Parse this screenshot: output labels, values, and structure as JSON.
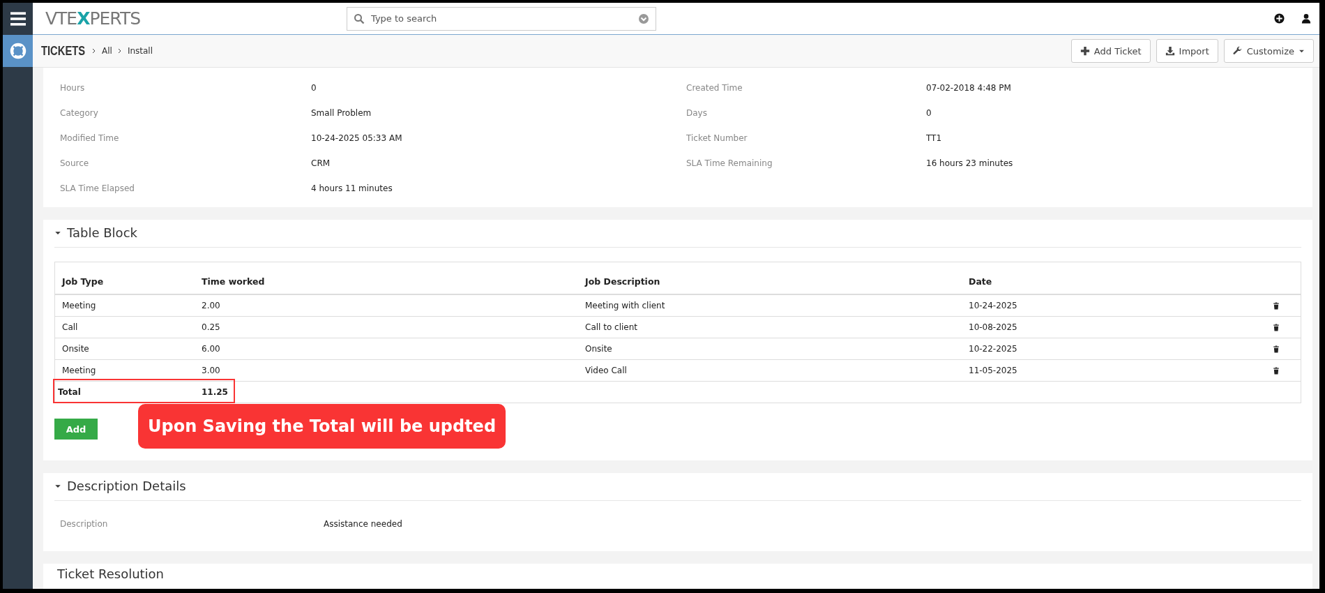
{
  "header": {
    "logo": [
      {
        "text": "VTE",
        "accent": false
      },
      {
        "text": "X",
        "accent": true
      },
      {
        "text": "PERTS",
        "accent": false
      }
    ],
    "search": {
      "placeholder": "Type to search"
    }
  },
  "breadcrumb": {
    "module": "TICKETS",
    "path": [
      "All",
      "Install"
    ]
  },
  "actions": [
    {
      "label": "Add Ticket",
      "kind": "add"
    },
    {
      "label": "Import",
      "kind": "import"
    },
    {
      "label": "Customize",
      "kind": "customize"
    }
  ],
  "details": [
    {
      "label": "Hours",
      "value": "0"
    },
    {
      "label": "Created Time",
      "value": "07-02-2018 4:48 PM"
    },
    {
      "label": "Category",
      "value": "Small Problem"
    },
    {
      "label": "Days",
      "value": "0"
    },
    {
      "label": "Modified Time",
      "value": "10-24-2025 05:33 AM"
    },
    {
      "label": "Ticket Number",
      "value": "TT1"
    },
    {
      "label": "Source",
      "value": "CRM"
    },
    {
      "label": "SLA Time Remaining",
      "value": "16 hours 23 minutes"
    },
    {
      "label": "SLA Time Elapsed",
      "value": "4 hours 11 minutes"
    }
  ],
  "table_block": {
    "title": "Table Block",
    "columns": [
      "Job Type",
      "Time worked",
      "Job Description",
      "Date"
    ],
    "rows": [
      [
        "Meeting",
        "2.00",
        "Meeting with client",
        "10-24-2025"
      ],
      [
        "Call",
        "0.25",
        "Call to client",
        "10-08-2025"
      ],
      [
        "Onsite",
        "6.00",
        "Onsite",
        "10-22-2025"
      ],
      [
        "Meeting",
        "3.00",
        "Video Call",
        "11-05-2025"
      ]
    ],
    "total": {
      "label": "Total",
      "value": "11.25"
    },
    "add_button": "Add"
  },
  "annotation": {
    "text": "Upon Saving the Total will be updted"
  },
  "description_block": {
    "title": "Description Details",
    "label": "Description",
    "value": "Assistance needed"
  },
  "next_block": {
    "title": "Ticket Resolution"
  }
}
